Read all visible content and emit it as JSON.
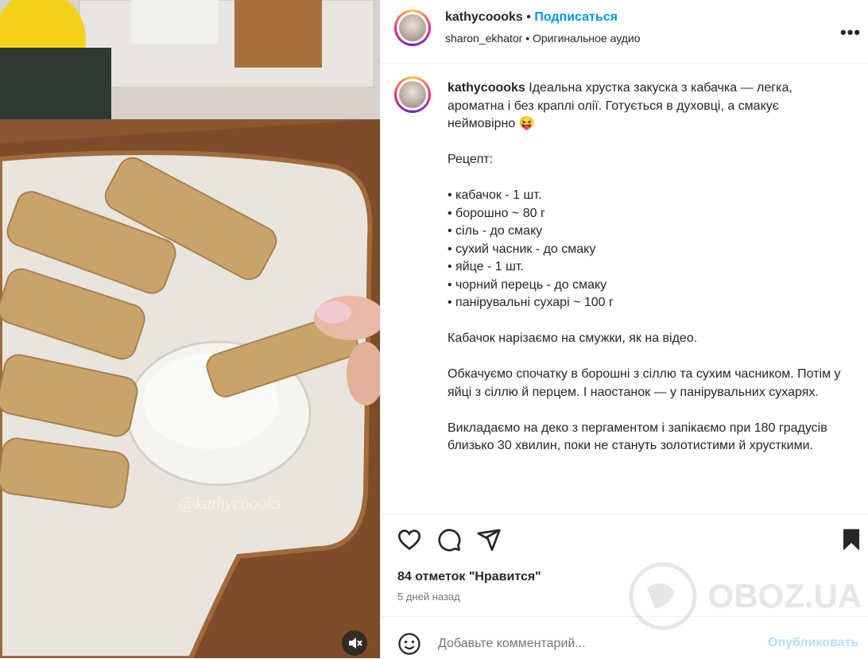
{
  "post": {
    "username": "kathycoooks",
    "follow_label": "Подписаться",
    "audio_user": "sharon_ekhator",
    "audio_label": "Оригинальное аудио",
    "more_label": "•••"
  },
  "caption": {
    "username": "kathycoooks",
    "text": "Ідеальна хрустка закуска з кабачка — легка, ароматна і без краплі олії. Готується в духовці, а смакує неймовірно 😝\n\nРецепт:\n\n• кабачок - 1 шт.\n• борошно ~ 80 г\n• сіль - до смаку\n• сухий часник - до смаку\n• яйце - 1 шт.\n• чорний перець - до смаку\n• панірувальні сухарі ~ 100 г\n\nКабачок нарізаємо на смужки, як на відео.\n\nОбкачуємо спочатку в борошні з сіллю та сухим часником. Потім у яйці з сіллю й перцем. І наостанок — у панірувальних сухарях.\n\nВикладаємо на деко з пергаментом і запікаємо при 180 градусів близько 30 хвилин, поки не стануть золотистими й хрусткими."
  },
  "stats": {
    "likes": "84 отметок \"Нравится\"",
    "date": "5 дней назад"
  },
  "comment": {
    "placeholder": "Добавьте комментарий...",
    "publish_label": "Опубликовать"
  },
  "media": {
    "watermark": "@kathycoooks",
    "mute_icon": "muted-speaker-icon"
  },
  "site_watermark": "OBOZ.UA",
  "colors": {
    "accent": "#0095f6",
    "publish_disabled": "#b2dffc",
    "text": "#262626",
    "muted": "#737373"
  }
}
